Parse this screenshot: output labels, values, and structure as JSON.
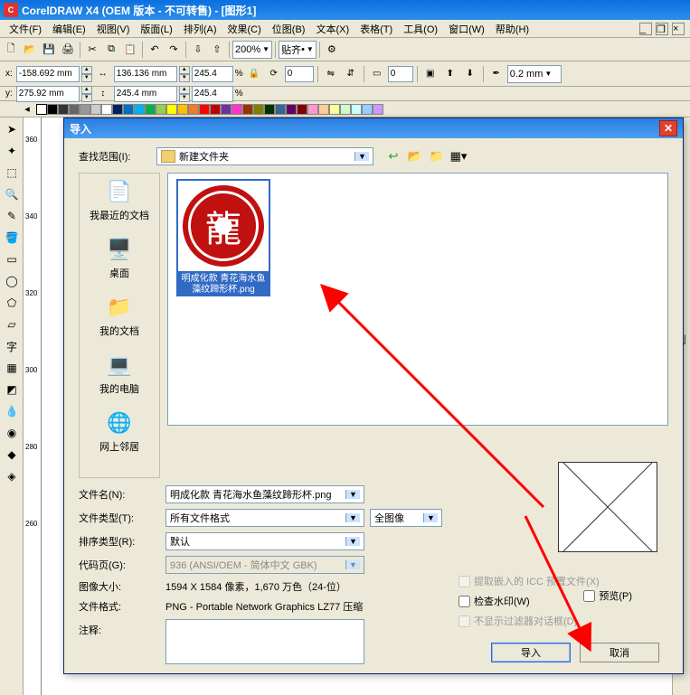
{
  "titlebar": {
    "text": "CorelDRAW X4 (OEM 版本 - 不可转售) - [图形1]",
    "app_badge": "C"
  },
  "menu": {
    "items": [
      "文件(F)",
      "编辑(E)",
      "视图(V)",
      "版面(L)",
      "排列(A)",
      "效果(C)",
      "位图(B)",
      "文本(X)",
      "表格(T)",
      "工具(O)",
      "窗口(W)",
      "帮助(H)"
    ]
  },
  "toolbar": {
    "zoom": "200%",
    "paste_label": "贴齐"
  },
  "propbar": {
    "x_label": "x:",
    "x_val": "-158.692 mm",
    "y_label": "y:",
    "y_val": "275.92 mm",
    "w_val": "136.136 mm",
    "h_val": "245.4 mm",
    "sx": "245.4",
    "sy": "245.4",
    "rot": "0",
    "units_val": "0",
    "outline": "0.2 mm"
  },
  "ruler_ticks": [
    "360",
    "340",
    "320",
    "300",
    "280",
    "260"
  ],
  "dialog": {
    "title": "导入",
    "look_label": "查找范围(I):",
    "look_folder": "新建文件夹",
    "places": [
      {
        "icon": "📄",
        "label": "我最近的文档"
      },
      {
        "icon": "🖥️",
        "label": "桌面"
      },
      {
        "icon": "📁",
        "label": "我的文档"
      },
      {
        "icon": "💻",
        "label": "我的电脑"
      },
      {
        "icon": "🌐",
        "label": "网上邻居"
      }
    ],
    "file_name_sel": "明成化款 青花海水鱼藻纹蹄形杯.png",
    "form": {
      "filename_lbl": "文件名(N):",
      "filename_val": "明成化款 青花海水鱼藻纹蹄形杯.png",
      "filetype_lbl": "文件类型(T):",
      "filetype_val": "所有文件格式",
      "fullimg": "全图像",
      "preview_lbl": "预览(P)",
      "sort_lbl": "排序类型(R):",
      "sort_val": "默认",
      "codepage_lbl": "代码页(G):",
      "codepage_val": "936 (ANSI/OEM - 简体中文 GBK)",
      "imgsize_lbl": "图像大小:",
      "imgsize_val": "1594 X 1584 像素，1,670 万色（24-位）",
      "filefmt_lbl": "文件格式:",
      "filefmt_val": "PNG - Portable Network Graphics LZ77 压缩",
      "notes_lbl": "注释:"
    },
    "checks": {
      "icc": "提取嵌入的 ICC 预置文件(X)",
      "watermark": "检查水印(W)",
      "nodlg": "不显示过滤器对话框(D)"
    },
    "buttons": {
      "import": "导入",
      "cancel": "取消"
    }
  },
  "right_panel": {
    "del_char": "删"
  }
}
